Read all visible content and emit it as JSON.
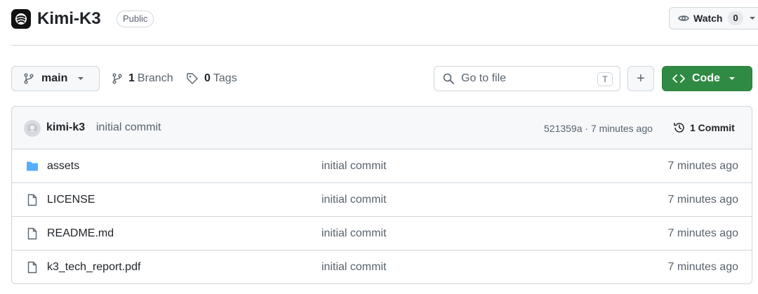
{
  "repo": {
    "name": "Kimi-K3",
    "visibility": "Public"
  },
  "watch": {
    "label": "Watch",
    "count": "0"
  },
  "toolbar": {
    "branch": "main",
    "branch_count": "1",
    "branch_label": "Branch",
    "tag_count": "0",
    "tag_label": "Tags",
    "search_placeholder": "Go to file",
    "search_shortcut": "T",
    "add_label": "+",
    "code_label": "Code"
  },
  "latest_commit": {
    "author": "kimi-k3",
    "message": "initial commit",
    "hash_time": "521359a · 7 minutes ago",
    "commit_count": "1 Commit"
  },
  "files": [
    {
      "name": "assets",
      "type": "folder",
      "commit": "initial commit",
      "time": "7 minutes ago"
    },
    {
      "name": "LICENSE",
      "type": "file",
      "commit": "initial commit",
      "time": "7 minutes ago"
    },
    {
      "name": "README.md",
      "type": "file",
      "commit": "initial commit",
      "time": "7 minutes ago"
    },
    {
      "name": "k3_tech_report.pdf",
      "type": "file",
      "commit": "initial commit",
      "time": "7 minutes ago"
    }
  ],
  "colors": {
    "code_button": "#2f8b43",
    "folder": "#54aeff",
    "border": "#d0d7de",
    "muted_text": "#59636e"
  },
  "icons": {
    "logo": "kimi-logo-icon",
    "watch": "eye-icon",
    "branch": "git-branch-icon",
    "tag": "tag-icon",
    "search": "search-icon",
    "code": "code-icon",
    "history": "history-icon",
    "folder": "folder-icon",
    "file": "file-icon"
  }
}
